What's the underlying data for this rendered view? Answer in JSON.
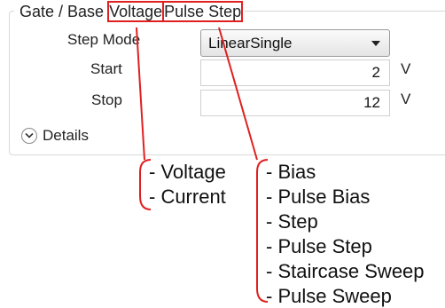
{
  "group": {
    "title_prefix": "Gate / Base",
    "source_mode": "Voltage",
    "operation_mode": "Pulse Step"
  },
  "fields": {
    "step_mode_label": "Step Mode",
    "step_mode_value": "LinearSingle",
    "start_label": "Start",
    "start_value": "2",
    "start_unit": "V",
    "stop_label": "Stop",
    "stop_value": "12",
    "stop_unit": "V"
  },
  "details_label": "Details",
  "annotations": {
    "source_mode_options": [
      "- Voltage",
      "- Current"
    ],
    "operation_mode_options": [
      "- Bias",
      "- Pulse Bias",
      "- Step",
      "- Pulse Step",
      "- Staircase Sweep",
      "- Pulse Sweep"
    ]
  },
  "colors": {
    "highlight": "#e02020",
    "text": "#222222",
    "border": "#d9d9d9"
  }
}
